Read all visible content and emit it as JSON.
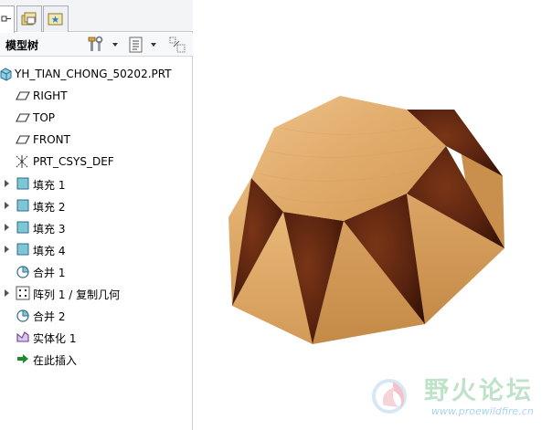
{
  "navigator": {
    "tabs": [
      {
        "name": "model-tree",
        "icon": "model-tree-icon"
      },
      {
        "name": "folder-browser",
        "icon": "folder-browser-icon"
      },
      {
        "name": "favorites",
        "icon": "favorites-icon"
      }
    ]
  },
  "toolbar": {
    "title": "模型树",
    "settings_icon": "tools-icon",
    "show_icon": "tree-columns-icon",
    "filter_icon": "tree-filter-icon"
  },
  "tree": {
    "items": [
      {
        "label": "YH_TIAN_CHONG_50202.PRT",
        "icon": "part-icon",
        "expandable": false
      },
      {
        "label": "RIGHT",
        "icon": "datum-plane-icon",
        "expandable": false
      },
      {
        "label": "TOP",
        "icon": "datum-plane-icon",
        "expandable": false
      },
      {
        "label": "FRONT",
        "icon": "datum-plane-icon",
        "expandable": false
      },
      {
        "label": "PRT_CSYS_DEF",
        "icon": "coordinate-system-icon",
        "expandable": false
      },
      {
        "label": "填充 1",
        "icon": "fill-surface-icon",
        "expandable": true
      },
      {
        "label": "填充 2",
        "icon": "fill-surface-icon",
        "expandable": true
      },
      {
        "label": "填充 3",
        "icon": "fill-surface-icon",
        "expandable": true
      },
      {
        "label": "填充 4",
        "icon": "fill-surface-icon",
        "expandable": true
      },
      {
        "label": "合并 1",
        "icon": "merge-icon",
        "expandable": false
      },
      {
        "label": "阵列 1 / 复制几何",
        "icon": "pattern-icon",
        "expandable": true
      },
      {
        "label": "合并 2",
        "icon": "merge-icon",
        "expandable": false
      },
      {
        "label": "实体化 1",
        "icon": "solidify-icon",
        "expandable": false
      },
      {
        "label": "在此插入",
        "icon": "insert-here-arrow-icon",
        "expandable": false
      }
    ]
  },
  "colors": {
    "wood_light": "#e6b474",
    "wood_mid": "#d59a55",
    "wood_shade": "#c28845",
    "walnut": "#5a2410",
    "walnut_dark": "#3a1508",
    "plane_icon": "#333333",
    "fill_icon": "#7fc6d6",
    "insert_arrow": "#1d8a2e"
  },
  "watermark": {
    "title": "野火论坛",
    "url": "www.proewildfire.cn"
  }
}
